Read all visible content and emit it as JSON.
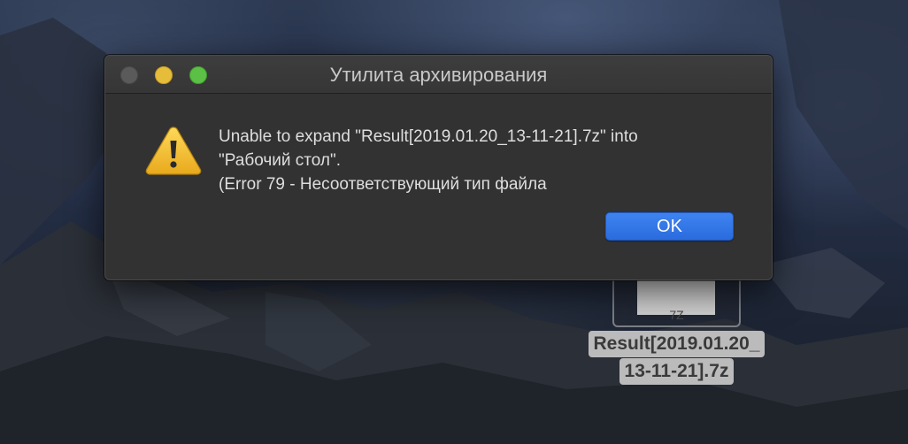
{
  "window": {
    "title": "Утилита архивирования"
  },
  "alert": {
    "icon": "warning-triangle-icon",
    "message_lines": [
      "Unable to expand \"Result[2019.01.20_13-11-21].7z\" into",
      "\"Рабочий стол\".",
      "(Error 79 - Несоответствующий тип файла"
    ],
    "ok_label": "OK"
  },
  "desktop": {
    "file": {
      "icon": "archive-file-icon",
      "extension": "7Z",
      "name_lines": [
        "Result[2019.01.20_",
        "13-11-21].7z"
      ]
    }
  },
  "colors": {
    "accent": "#2f72e6",
    "dialog_background": "#323232",
    "warning": "#f2c12e",
    "traffic_minimize": "#e6bd3a",
    "traffic_zoom": "#5cc046"
  }
}
